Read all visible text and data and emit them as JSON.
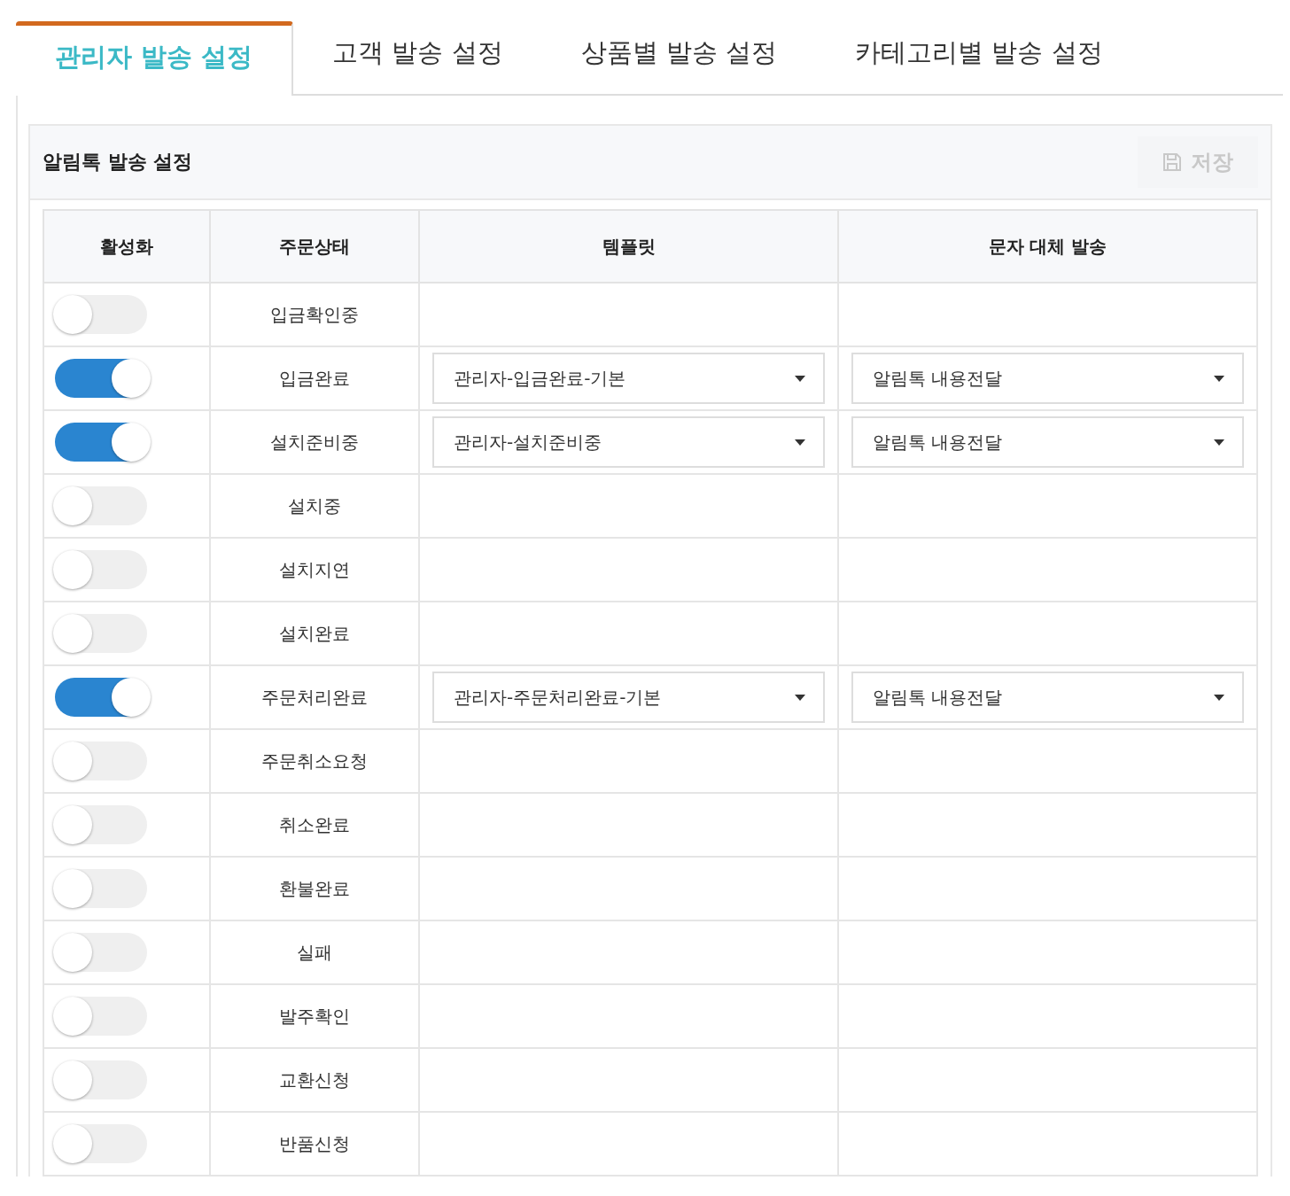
{
  "tabs": [
    {
      "label": "관리자 발송 설정",
      "selected": true
    },
    {
      "label": "고객 발송 설정",
      "selected": false
    },
    {
      "label": "상품별 발송 설정",
      "selected": false
    },
    {
      "label": "카테고리별 발송 설정",
      "selected": false
    }
  ],
  "panel": {
    "title": "알림톡 발송 설정",
    "save_button": {
      "label": "저장",
      "disabled": true
    }
  },
  "table": {
    "columns": [
      "활성화",
      "주문상태",
      "템플릿",
      "문자 대체 발송"
    ],
    "rows": [
      {
        "on": false,
        "status": "입금확인중"
      },
      {
        "on": true,
        "status": "입금완료",
        "template": "관리자-입금완료-기본",
        "fallback": "알림톡 내용전달"
      },
      {
        "on": true,
        "status": "설치준비중",
        "template": "관리자-설치준비중",
        "fallback": "알림톡 내용전달"
      },
      {
        "on": false,
        "status": "설치중"
      },
      {
        "on": false,
        "status": "설치지연"
      },
      {
        "on": false,
        "status": "설치완료"
      },
      {
        "on": true,
        "status": "주문처리완료",
        "template": "관리자-주문처리완료-기본",
        "fallback": "알림톡 내용전달"
      },
      {
        "on": false,
        "status": "주문취소요청"
      },
      {
        "on": false,
        "status": "취소완료"
      },
      {
        "on": false,
        "status": "환불완료"
      },
      {
        "on": false,
        "status": "실패"
      },
      {
        "on": false,
        "status": "발주확인"
      },
      {
        "on": false,
        "status": "교환신청"
      },
      {
        "on": false,
        "status": "반품신청"
      }
    ]
  }
}
